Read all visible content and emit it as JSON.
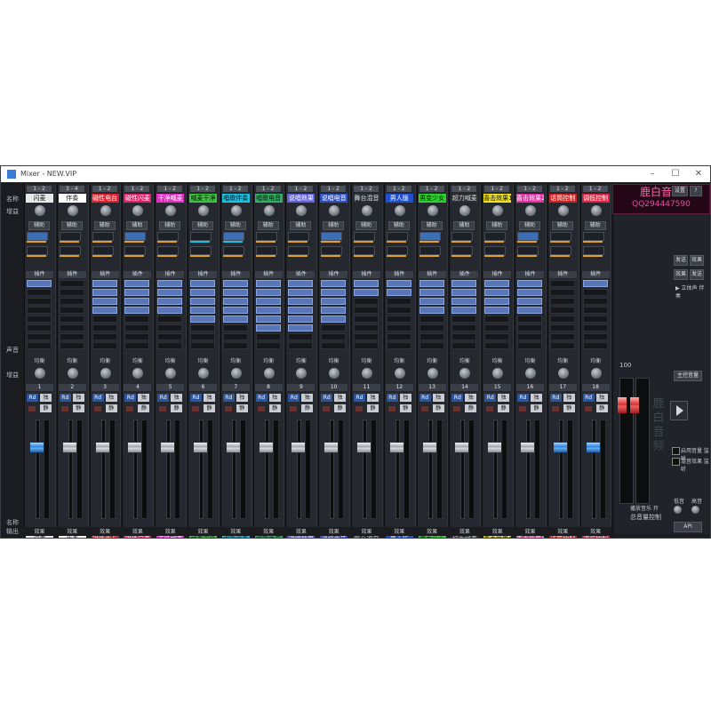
{
  "window": {
    "title": "Mixer - NEW.VIP",
    "minimize": "–",
    "maximize": "☐",
    "close": "✕"
  },
  "logo": {
    "line1": "鹿白音频",
    "line2": "QQ294447590"
  },
  "row_labels": {
    "name": "名称",
    "trim": "增益",
    "aux": "辅助",
    "plugins": "插件",
    "eq": "均衡",
    "output": "输出",
    "name_bottom": "名称",
    "out_bottom": "输出",
    "vol": "声音"
  },
  "colors": {
    "bg": "#1a1c20",
    "strip": "#25282e",
    "accent": "#3d6fb7",
    "fader_blue": "#2c7fd6",
    "fader_red": "#d63030"
  },
  "channels": [
    {
      "num": "1",
      "io": "1 - 2",
      "name": "闪麦",
      "color": "#e8e8e8",
      "textcolor": "#111",
      "fader": 0.72,
      "cap": "blue",
      "slots": 1
    },
    {
      "num": "2",
      "io": "3 - 4",
      "name": "伴奏",
      "color": "#ffffff",
      "textcolor": "#111",
      "fader": 0.72,
      "cap": "grey",
      "slots": 0
    },
    {
      "num": "3",
      "io": "1 - 2",
      "name": "磁性电台",
      "color": "#e0202a",
      "textcolor": "#fff",
      "fader": 0.72,
      "cap": "grey",
      "slots": 4
    },
    {
      "num": "4",
      "io": "1 - 2",
      "name": "磁性闪麦",
      "color": "#e0206a",
      "textcolor": "#fff",
      "fader": 0.72,
      "cap": "grey",
      "slots": 4
    },
    {
      "num": "5",
      "io": "1 - 2",
      "name": "干净喊麦",
      "color": "#e030c0",
      "textcolor": "#fff",
      "fader": 0.72,
      "cap": "grey",
      "slots": 4
    },
    {
      "num": "6",
      "io": "1 - 2",
      "name": "喊麦干净",
      "color": "#40c040",
      "textcolor": "#111",
      "fader": 0.72,
      "cap": "grey",
      "slots": 5
    },
    {
      "num": "7",
      "io": "1 - 2",
      "name": "唱歌伴奏",
      "color": "#20c0e0",
      "textcolor": "#111",
      "fader": 0.72,
      "cap": "grey",
      "slots": 5
    },
    {
      "num": "8",
      "io": "1 - 2",
      "name": "唱歌电音",
      "color": "#30b060",
      "textcolor": "#111",
      "fader": 0.72,
      "cap": "grey",
      "slots": 6
    },
    {
      "num": "9",
      "io": "1 - 2",
      "name": "说唱效果",
      "color": "#6060e0",
      "textcolor": "#fff",
      "fader": 0.72,
      "cap": "grey",
      "slots": 6
    },
    {
      "num": "10",
      "io": "1 - 2",
      "name": "说唱电音",
      "color": "#3050c0",
      "textcolor": "#fff",
      "fader": 0.72,
      "cap": "grey",
      "slots": 5
    },
    {
      "num": "11",
      "io": "1 - 2",
      "name": "舞台混音",
      "color": "#2a2d33",
      "textcolor": "#ddd",
      "fader": 0.72,
      "cap": "grey",
      "slots": 2
    },
    {
      "num": "12",
      "io": "1 - 2",
      "name": "男人版",
      "color": "#2050d0",
      "textcolor": "#fff",
      "fader": 0.72,
      "cap": "grey",
      "slots": 2
    },
    {
      "num": "13",
      "io": "1 - 2",
      "name": "男变少女",
      "color": "#30d030",
      "textcolor": "#111",
      "fader": 0.72,
      "cap": "grey",
      "slots": 4
    },
    {
      "num": "14",
      "io": "1 - 2",
      "name": "超力喊麦",
      "color": "#2a2d33",
      "textcolor": "#ddd",
      "fader": 0.72,
      "cap": "grey",
      "slots": 4
    },
    {
      "num": "15",
      "io": "1 - 2",
      "name": "喜击效果1",
      "color": "#f0e020",
      "textcolor": "#111",
      "fader": 0.72,
      "cap": "grey",
      "slots": 4
    },
    {
      "num": "16",
      "io": "1 - 2",
      "name": "喜击效果2",
      "color": "#e030a0",
      "textcolor": "#fff",
      "fader": 0.72,
      "cap": "grey",
      "slots": 4
    },
    {
      "num": "17",
      "io": "1 - 2",
      "name": "话筒控制",
      "color": "#d02020",
      "textcolor": "#fff",
      "fader": 0.72,
      "cap": "blue",
      "slots": 0
    },
    {
      "num": "18",
      "io": "1 - 2",
      "name": "调低控制",
      "color": "#e02040",
      "textcolor": "#fff",
      "fader": 0.72,
      "cap": "blue",
      "slots": 1
    }
  ],
  "strip_labels": {
    "rd": "Rd",
    "solo": "独",
    "mute": "静",
    "plugin_hdr": "插件",
    "eq_hdr": "均衡",
    "fx": "效果",
    "aux_btn": "辅助"
  },
  "master": {
    "label": "主控音量",
    "value": "100",
    "total": "总音量控制",
    "preview": "播放音乐 开",
    "name": "预设"
  },
  "right_panel": {
    "settings": "设置",
    "help": "?",
    "send_label": "发送",
    "effect": "效果",
    "effect2": "效果",
    "send2": "发送",
    "check1": "启用音量 监听",
    "check2": "混音效果 监听",
    "speed": "低音",
    "treble": "高音",
    "stereo": "▶ 立体声 伴奏",
    "api": "API",
    "box_label": "播放"
  }
}
